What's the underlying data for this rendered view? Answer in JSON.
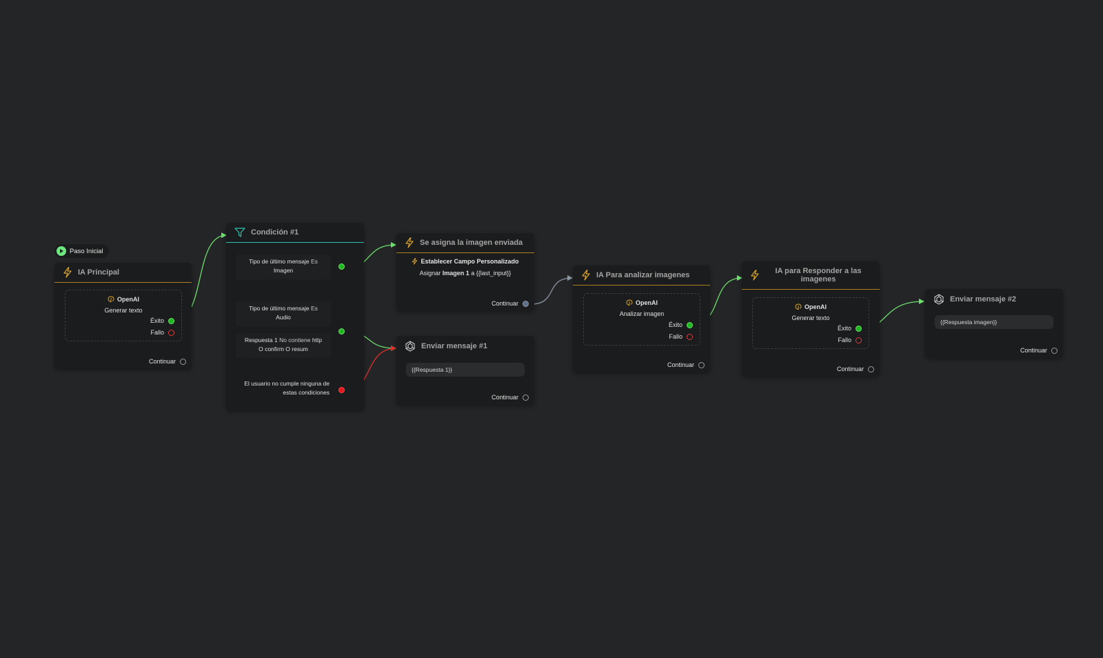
{
  "start": {
    "label": "Paso Inicial"
  },
  "nodes": {
    "ia_principal": {
      "title": "IA Principal",
      "provider": "OpenAI",
      "action": "Generar texto",
      "success_label": "Éxito",
      "fail_label": "Fallo",
      "continue_label": "Continuar"
    },
    "condicion": {
      "title": "Condición #1",
      "conditions": [
        {
          "line1": "Tipo de último mensaje",
          "op": "Es",
          "value": "Imagen"
        },
        {
          "line1": "Tipo de último mensaje",
          "op": "Es",
          "value": "Audio"
        },
        {
          "field": "Respuesta 1",
          "op": "No contiene",
          "value": "http",
          "line2": "O confirm O resum"
        }
      ],
      "else_label": "El usuario no cumple ninguna de estas condiciones"
    },
    "asigna_imagen": {
      "title": "Se asigna la imagen enviada",
      "action_title": "Establecer Campo Personalizado",
      "assign_prefix": "Asignar",
      "assign_field": "Imagen 1",
      "assign_mid": "a",
      "assign_value": "{{last_input}}",
      "continue_label": "Continuar"
    },
    "enviar_1": {
      "title": "Enviar mensaje #1",
      "message": "{{Respuesta 1}}",
      "continue_label": "Continuar"
    },
    "ia_analizar": {
      "title": "IA Para analizar imagenes",
      "provider": "OpenAI",
      "action": "Analizar imagen",
      "success_label": "Éxito",
      "fail_label": "Fallo",
      "continue_label": "Continuar"
    },
    "ia_responder": {
      "title": "IA para Responder a las imagenes",
      "provider": "OpenAI",
      "action": "Generar texto",
      "success_label": "Éxito",
      "fail_label": "Fallo",
      "continue_label": "Continuar"
    },
    "enviar_2": {
      "title": "Enviar mensaje #2",
      "message": "{{Respuesta imagen}}",
      "continue_label": "Continuar"
    }
  },
  "colors": {
    "background": "#242526",
    "node": "#1b1c1d",
    "accent_orange": "#b07d21",
    "accent_teal": "#2fc2b0",
    "edge_green": "#6ee06e",
    "edge_red": "#e0302f",
    "edge_grey": "#8c95a3"
  },
  "icons": {
    "ai_node": "lightning-icon",
    "condition_node": "filter-icon",
    "message_node": "openai-icon",
    "provider": "brain-icon",
    "start": "play-icon"
  }
}
